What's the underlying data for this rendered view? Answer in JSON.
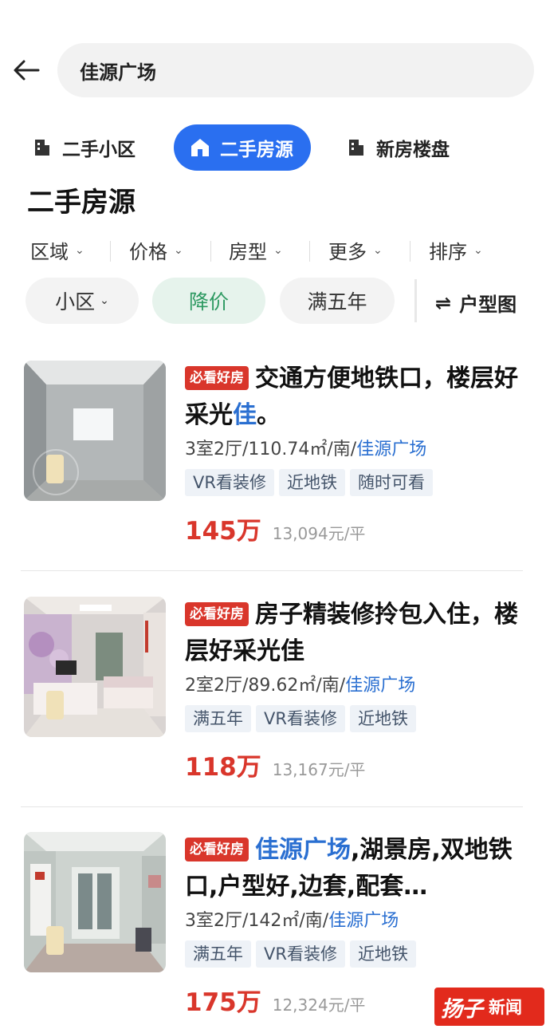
{
  "search": {
    "query": "佳源广场"
  },
  "categories": [
    {
      "label": "二手小区",
      "icon": "building-icon"
    },
    {
      "label": "二手房源",
      "icon": "house-icon",
      "active": true
    },
    {
      "label": "新房楼盘",
      "icon": "building-icon"
    }
  ],
  "section_title": "二手房源",
  "filters": [
    "区域",
    "价格",
    "房型",
    "更多",
    "排序"
  ],
  "chips": [
    {
      "label": "小区",
      "caret": true
    },
    {
      "label": "降价",
      "highlight": true
    },
    {
      "label": "满五年"
    }
  ],
  "floor_plan_label": "户型图",
  "accent_colors": {
    "primary_blue": "#2a6ff0",
    "price_red": "#d9362b",
    "chip_green": "#2e9a62"
  },
  "listings": [
    {
      "badge": "必看好房",
      "title_pre": "交通方便地铁口，楼层好采光",
      "title_hl": "佳",
      "title_post": "。",
      "meta_pre": "3室2厅/110.74㎡/南/",
      "meta_community": "佳源广场",
      "tags": [
        "VR看装修",
        "近地铁",
        "随时可看"
      ],
      "price": "145万",
      "unit_price": "13,094元/平"
    },
    {
      "badge": "必看好房",
      "title_pre": "房子精装修拎包入住，楼层好采光佳",
      "title_hl": "",
      "title_post": "",
      "meta_pre": "2室2厅/89.62㎡/南/",
      "meta_community": "佳源广场",
      "tags": [
        "满五年",
        "VR看装修",
        "近地铁"
      ],
      "price": "118万",
      "unit_price": "13,167元/平"
    },
    {
      "badge": "必看好房",
      "title_pre": "",
      "title_hl": "佳源广场",
      "title_post": ",湖景房,双地铁口,户型好,边套,配套…",
      "meta_pre": "3室2厅/142㎡/南/",
      "meta_community": "佳源广场",
      "tags": [
        "满五年",
        "VR看装修",
        "近地铁"
      ],
      "price": "175万",
      "unit_price": "12,324元/平"
    }
  ],
  "watermark": {
    "logo": "扬子",
    "text": "新闻"
  }
}
